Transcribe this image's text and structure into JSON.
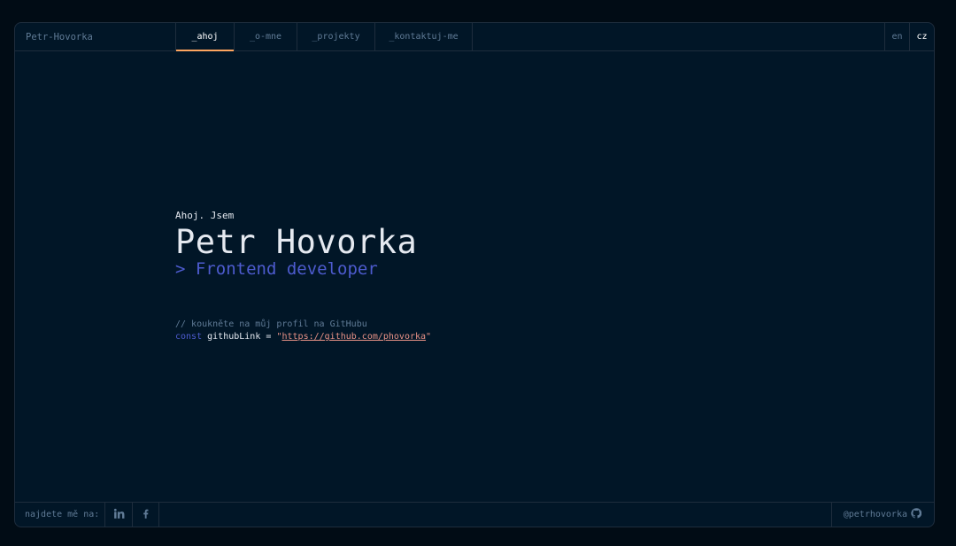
{
  "header": {
    "brand": "Petr-Hovorka",
    "tabs": [
      {
        "label": "_ahoj",
        "active": true
      },
      {
        "label": "_o-mne",
        "active": false
      },
      {
        "label": "_projekty",
        "active": false
      },
      {
        "label": "_kontaktuj-me",
        "active": false
      }
    ],
    "languages": [
      {
        "label": "en",
        "active": false
      },
      {
        "label": "cz",
        "active": true
      }
    ]
  },
  "hero": {
    "greeting": "Ahoj. Jsem",
    "name": "Petr Hovorka",
    "role": "> Frontend developer"
  },
  "code": {
    "comment": "// koukněte na můj profil na GitHubu",
    "keyword": "const",
    "variable": "githubLink",
    "operator": "=",
    "quote": "\"",
    "link": "https://github.com/phovorka"
  },
  "footer": {
    "find_label": "najdete mě na:",
    "social_icons": [
      "linkedin-icon",
      "facebook-icon"
    ],
    "github_handle": "@petrhovorka",
    "github_icon": "github-icon"
  },
  "colors": {
    "background": "#010c15",
    "panel": "#011627",
    "border": "#1e2d3d",
    "muted": "#607b96",
    "accent": "#4d5bce",
    "string": "#e99287",
    "active_tab_underline": "#fea55f"
  }
}
